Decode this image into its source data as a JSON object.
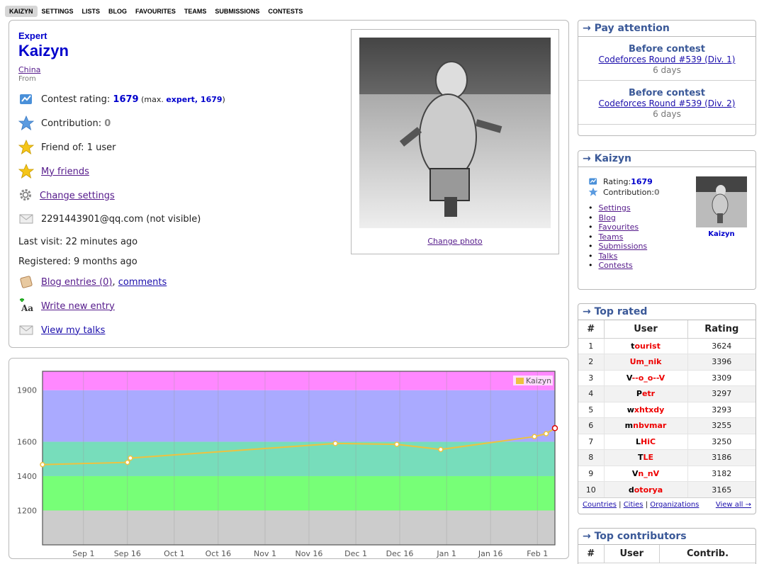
{
  "nav": {
    "items": [
      "KAIZYN",
      "SETTINGS",
      "LISTS",
      "BLOG",
      "FAVOURITES",
      "TEAMS",
      "SUBMISSIONS",
      "CONTESTS"
    ]
  },
  "profile": {
    "rank": "Expert",
    "handle": "Kaizyn",
    "country": "China",
    "from_label": "From",
    "rating_label": "Contest rating: ",
    "rating": "1679",
    "max_open": " (max. ",
    "max_rank": "expert, 1679",
    "max_close": ")",
    "contribution_label": "Contribution: ",
    "contribution": "0",
    "friend_of": "Friend of: 1 user",
    "my_friends": "My friends",
    "change_settings": "Change settings",
    "email": "2291443901@qq.com (not visible)",
    "last_visit": "Last visit: 22 minutes ago",
    "registered": "Registered: 9 months ago",
    "blog_entries": "Blog entries (0)",
    "blog_sep": ", ",
    "comments": "comments",
    "write_new_entry": "Write new entry",
    "view_talks": "View my talks",
    "change_photo": "Change photo"
  },
  "chart_data": {
    "type": "line",
    "title": "",
    "x_ticks": [
      "Sep 1",
      "Sep 16",
      "Oct 1",
      "Oct 16",
      "Nov 1",
      "Nov 16",
      "Dec 1",
      "Dec 16",
      "Jan 1",
      "Jan 16",
      "Feb 1"
    ],
    "y_ticks": [
      1200,
      1400,
      1600,
      1900
    ],
    "ylim": [
      1000,
      2010
    ],
    "bands": [
      {
        "from": 1000,
        "to": 1200,
        "color": "#cccccc"
      },
      {
        "from": 1200,
        "to": 1400,
        "color": "#77ff77"
      },
      {
        "from": 1400,
        "to": 1600,
        "color": "#77ddbb"
      },
      {
        "from": 1600,
        "to": 1900,
        "color": "#aaaaff"
      },
      {
        "from": 1900,
        "to": 2010,
        "color": "#ff88ff"
      }
    ],
    "series": [
      {
        "name": "Kaizyn",
        "color": "#edc240",
        "x": [
          "Aug 18",
          "Sep 16",
          "Sep 17",
          "Nov 25",
          "Dec 15",
          "Dec 30",
          "Jan 31",
          "Feb 4",
          "Feb 7"
        ],
        "values": [
          1467,
          1480,
          1505,
          1590,
          1585,
          1555,
          1630,
          1647,
          1679
        ]
      }
    ],
    "legend": "top-right",
    "grid": true
  },
  "attention": {
    "title": "Pay attention",
    "items": [
      {
        "label": "Before contest",
        "contest": "Codeforces Round #539 (Div. 1)",
        "time": "6 days"
      },
      {
        "label": "Before contest",
        "contest": "Codeforces Round #539 (Div. 2)",
        "time": "6 days"
      }
    ]
  },
  "userbox": {
    "title": "Kaizyn",
    "rating_label": "Rating: ",
    "rating": "1679",
    "contribution_label": "Contribution: ",
    "contribution": "0",
    "links": [
      "Settings",
      "Blog",
      "Favourites",
      "Teams",
      "Submissions",
      "Talks",
      "Contests"
    ],
    "name": "Kaizyn"
  },
  "top_rated": {
    "title": "Top rated",
    "headers": [
      "#",
      "User",
      "Rating"
    ],
    "rows": [
      {
        "n": "1",
        "first": "t",
        "rest": "ourist",
        "rating": "3624"
      },
      {
        "n": "2",
        "first": "",
        "rest": "Um_nik",
        "rating": "3396"
      },
      {
        "n": "3",
        "first": "V",
        "rest": "--o_o--V",
        "rating": "3309"
      },
      {
        "n": "4",
        "first": "P",
        "rest": "etr",
        "rating": "3297"
      },
      {
        "n": "5",
        "first": "w",
        "rest": "xhtxdy",
        "rating": "3293"
      },
      {
        "n": "6",
        "first": "m",
        "rest": "nbvmar",
        "rating": "3255"
      },
      {
        "n": "7",
        "first": "L",
        "rest": "HiC",
        "rating": "3250"
      },
      {
        "n": "8",
        "first": "T",
        "rest": "LE",
        "rating": "3186"
      },
      {
        "n": "9",
        "first": "V",
        "rest": "n_nV",
        "rating": "3182"
      },
      {
        "n": "10",
        "first": "d",
        "rest": "otorya",
        "rating": "3165"
      }
    ],
    "footer_links": [
      "Countries",
      "Cities",
      "Organizations"
    ],
    "view_all": "View all →"
  },
  "top_contributors": {
    "title": "Top contributors",
    "headers": [
      "#",
      "User",
      "Contrib."
    ]
  }
}
